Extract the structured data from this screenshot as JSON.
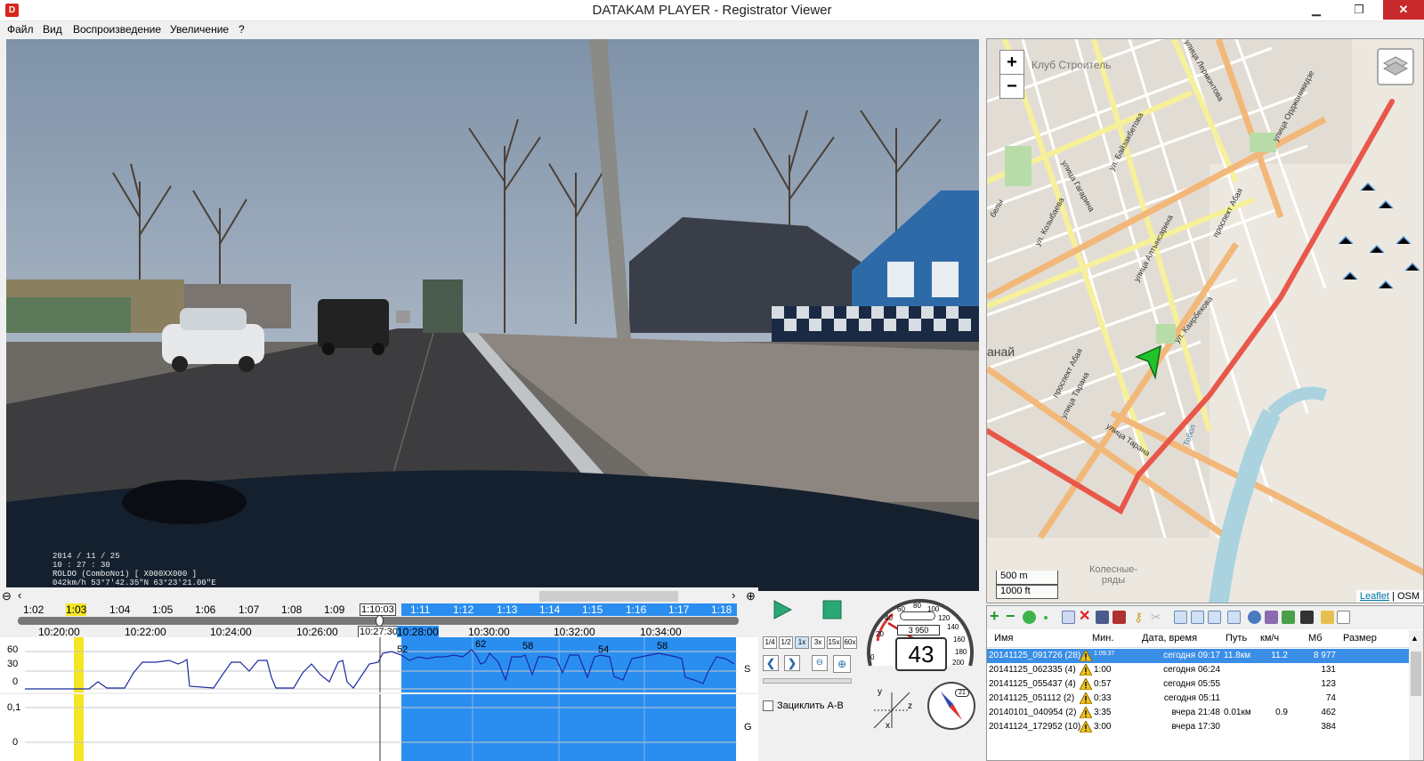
{
  "window": {
    "title": "DATAKAM PLAYER - Registrator Viewer",
    "app_icon": "D"
  },
  "menu": [
    "Файл",
    "Вид",
    "Воспроизведение",
    "Увеличение",
    "?"
  ],
  "video": {
    "osd": [
      "2014 / 11 / 25",
      "10 : 27 : 30",
      "ROLDO (ComboNo1)      [ X000XX000 ]",
      "042km/h 53°7'42.35\"N 63°23'21.00\"E"
    ]
  },
  "map": {
    "zoom_in": "+",
    "zoom_out": "−",
    "scale_metric": "500 m",
    "scale_imperial": "1000 ft",
    "attribution_leaflet": "Leaflet",
    "attribution_sep": "|",
    "attribution_osm": "OSM",
    "labels": [
      "Клуб Строитель",
      "улица Лермонтова",
      "улица Орджоникидзе",
      "ул. Байзакбетова",
      "улица Гагарина",
      "ул. Козыбаева",
      "проспект Абая",
      "улица Алтынсарина",
      "ул. Каирбекова",
      "проспект Абая",
      "улица Тарана",
      "улица Тарана",
      "Тобол",
      "Колесные-ряды",
      "анай",
      "белы"
    ]
  },
  "timeline": {
    "ruler_top": [
      "1:02",
      "1:03",
      "1:04",
      "1:05",
      "1:06",
      "1:07",
      "1:08",
      "1:09",
      "1:10:03",
      "1:11",
      "1:12",
      "1:13",
      "1:14",
      "1:15",
      "1:16",
      "1:17",
      "1:18"
    ],
    "ruler_bottom": [
      "10:20:00",
      "10:22:00",
      "10:24:00",
      "10:26:00",
      "10:27:30",
      "10:28:00",
      "10:30:00",
      "10:32:00",
      "10:34:00"
    ],
    "zoom_out_icon": "⊖",
    "zoom_in_icon": "⊕",
    "scroll_left": "‹",
    "scroll_right": "›"
  },
  "graph_s": {
    "yticks": [
      "60",
      "30",
      "0"
    ],
    "label": "S",
    "peaks": [
      "52",
      "62",
      "58",
      "54",
      "58"
    ]
  },
  "graph_g": {
    "yticks": [
      "0,1",
      "0"
    ],
    "label": "G"
  },
  "controls": {
    "speeds": [
      "1/4",
      "1/2",
      "1x",
      "3x",
      "15x",
      "60x"
    ],
    "loop_label": "Зациклить А-В"
  },
  "gauges": {
    "speed": "43",
    "odometer": "3 950",
    "dial_labels": [
      "0",
      "20",
      "40",
      "60",
      "80",
      "100",
      "120",
      "140",
      "160",
      "180",
      "200"
    ],
    "axis_x": "x",
    "axis_y": "y",
    "axis_z": "z",
    "compass_badge": "21"
  },
  "filelist": {
    "headers": [
      "Имя",
      "Мин.",
      "Дата, время",
      "Путь",
      "км/ч",
      "Мб",
      "Размер"
    ],
    "rows": [
      {
        "name": "20141125_091726 (28)",
        "min": "1:09:37",
        "date": "сегодня 09:17",
        "path": "11.8км",
        "kmh": "11.2",
        "mb": "8 977",
        "selected": true
      },
      {
        "name": "20141125_062335 (4)",
        "min": "1:00",
        "date": "сегодня 06:24",
        "path": "",
        "kmh": "",
        "mb": "131",
        "selected": false
      },
      {
        "name": "20141125_055437 (4)",
        "min": "0:57",
        "date": "сегодня 05:55",
        "path": "",
        "kmh": "",
        "mb": "123",
        "selected": false
      },
      {
        "name": "20141125_051112 (2)",
        "min": "0:33",
        "date": "сегодня 05:11",
        "path": "",
        "kmh": "",
        "mb": "74",
        "selected": false
      },
      {
        "name": "20140101_040954 (2)",
        "min": "3:35",
        "date": "вчера 21:48",
        "path": "0.01км",
        "kmh": "0.9",
        "mb": "462",
        "selected": false
      },
      {
        "name": "20141124_172952 (10)",
        "min": "3:00",
        "date": "вчера 17:30",
        "path": "",
        "kmh": "",
        "mb": "384",
        "selected": false
      }
    ]
  },
  "colors": {
    "selection": "#2a8ef0",
    "track": "#e8584a",
    "marker": "#22c22a"
  }
}
